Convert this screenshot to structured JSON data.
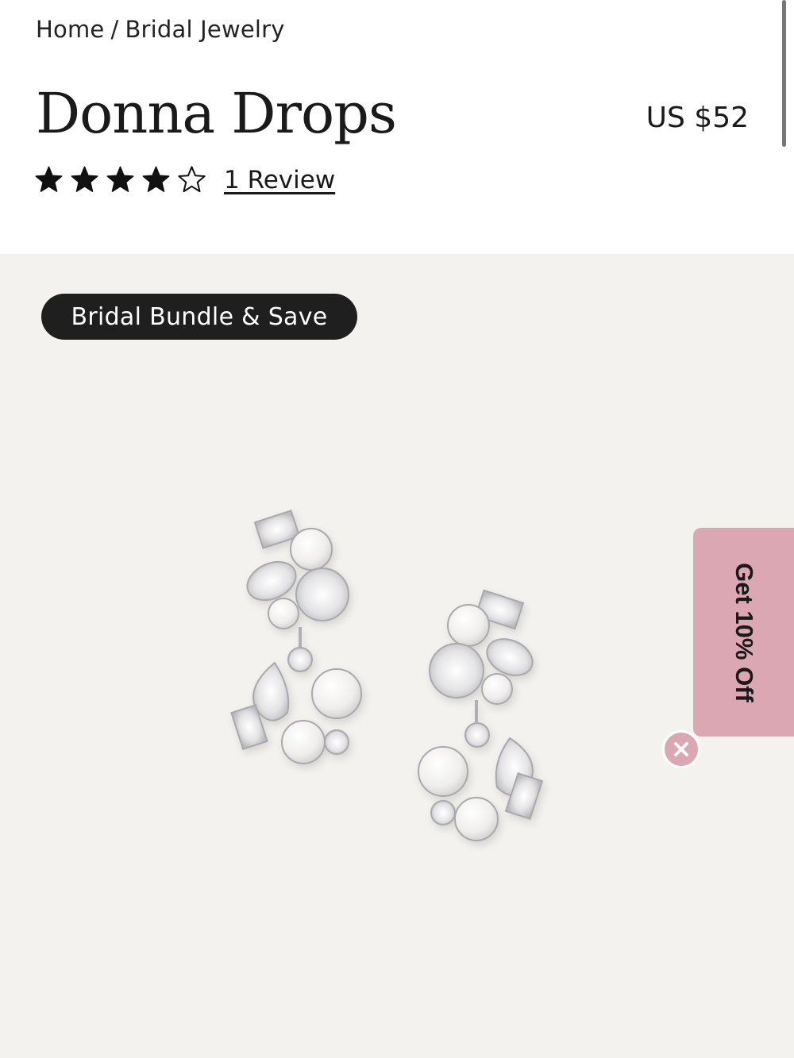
{
  "breadcrumb": {
    "home": "Home",
    "separator": "/",
    "current": "Bridal Jewelry"
  },
  "product": {
    "title": "Donna Drops",
    "price": "US $52",
    "rating": {
      "value": 4,
      "max": 5,
      "review_text": "1 Review"
    },
    "badge": "Bridal Bundle & Save"
  },
  "promo": {
    "label": "Get 10% Off",
    "close_icon": "close-icon"
  },
  "colors": {
    "accent_pink": "#dba7b3",
    "badge_bg": "#1f1f1f",
    "image_bg": "#f3f2ee",
    "text": "#1a1a1a"
  }
}
